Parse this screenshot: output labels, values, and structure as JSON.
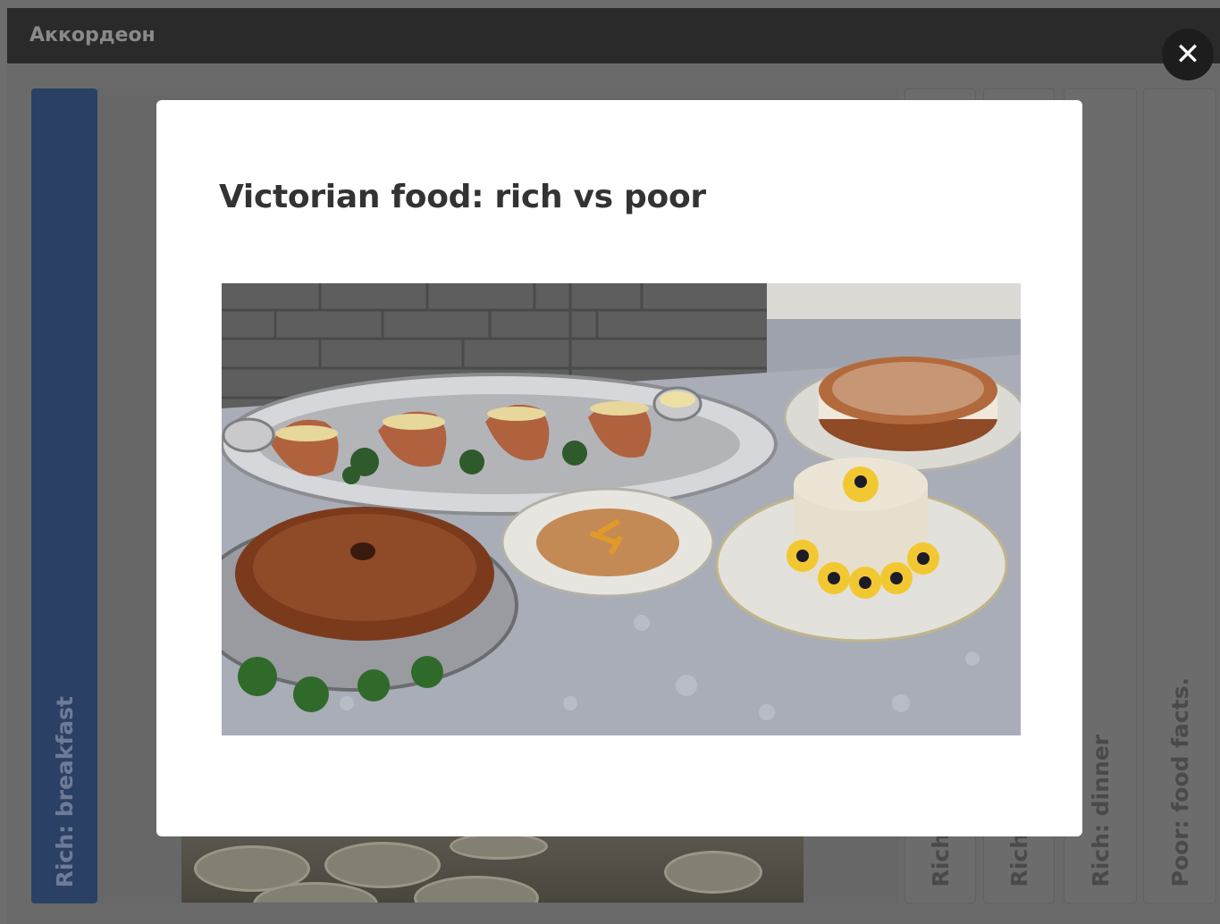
{
  "app": {
    "title": "Аккордеон"
  },
  "accordion": {
    "tabs": [
      {
        "label": "Rich: breakfast",
        "active": true
      },
      {
        "label": "Rich"
      },
      {
        "label": "Rich"
      },
      {
        "label": "Rich: dinner"
      },
      {
        "label": "Poor: food facts."
      }
    ]
  },
  "modal": {
    "title": "Victorian food: rich vs poor",
    "image_description_icon": "food-photo",
    "close_icon": "close-icon",
    "close_glyph": "✕"
  },
  "colors": {
    "active_tab": "#2a4064",
    "titlebar": "#2a2a2a",
    "modal_bg": "#ffffff",
    "title_text": "#333333"
  }
}
